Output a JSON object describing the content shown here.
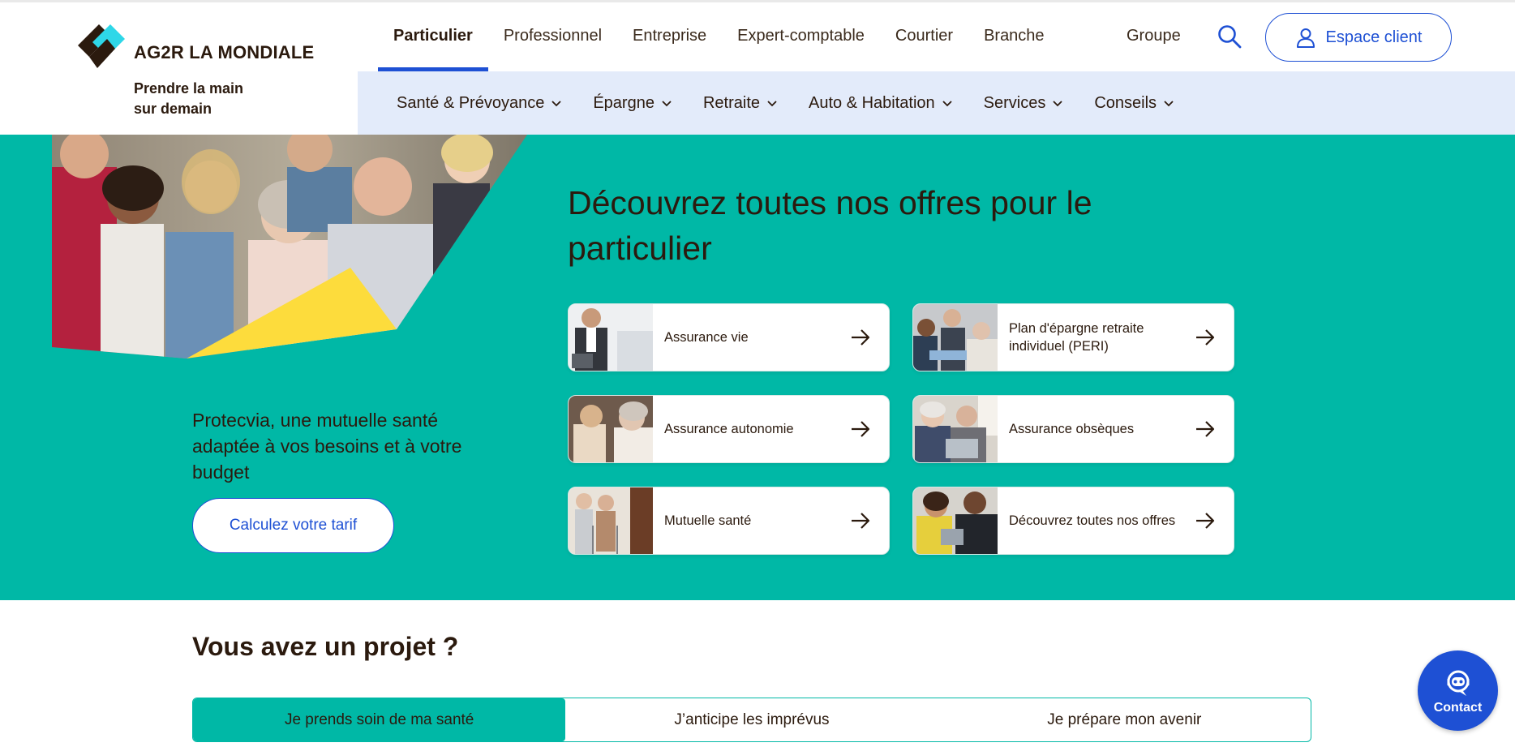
{
  "brand": {
    "name": "AG2R LA MONDIALE",
    "tagline_line1": "Prendre la main",
    "tagline_line2": "sur demain"
  },
  "top_nav": {
    "items": [
      {
        "label": "Particulier",
        "active": true
      },
      {
        "label": "Professionnel"
      },
      {
        "label": "Entreprise"
      },
      {
        "label": "Expert-comptable"
      },
      {
        "label": "Courtier"
      },
      {
        "label": "Branche"
      }
    ],
    "groupe": "Groupe",
    "espace_client": "Espace client"
  },
  "sub_nav": {
    "items": [
      {
        "label": "Santé & Prévoyance"
      },
      {
        "label": "Épargne"
      },
      {
        "label": "Retraite"
      },
      {
        "label": "Auto & Habitation"
      },
      {
        "label": "Services"
      },
      {
        "label": "Conseils"
      }
    ]
  },
  "hero": {
    "title": "Découvrez toutes nos offres pour le particulier",
    "promo": "Protecvia, une mutuelle santé adaptée à vos besoins et à votre budget",
    "cta": "Calculez votre tarif"
  },
  "offers": [
    {
      "label": "Assurance vie"
    },
    {
      "label": "Plan d'épargne retraite individuel (PERI)"
    },
    {
      "label": "Assurance autonomie"
    },
    {
      "label": "Assurance obsèques"
    },
    {
      "label": "Mutuelle santé"
    },
    {
      "label": "Découvrez toutes nos offres"
    }
  ],
  "projects": {
    "title": "Vous avez un projet ?",
    "tabs": [
      {
        "label": "Je prends soin de ma santé",
        "active": true
      },
      {
        "label": "J’anticipe les imprévus"
      },
      {
        "label": "Je prépare mon avenir"
      }
    ]
  },
  "contact": {
    "label": "Contact"
  },
  "colors": {
    "teal": "#00b8a6",
    "blue": "#1e50d4",
    "subnav_bg": "#e3ebfa",
    "accent_yellow": "#fddc3c",
    "text": "#2b1a0e"
  }
}
